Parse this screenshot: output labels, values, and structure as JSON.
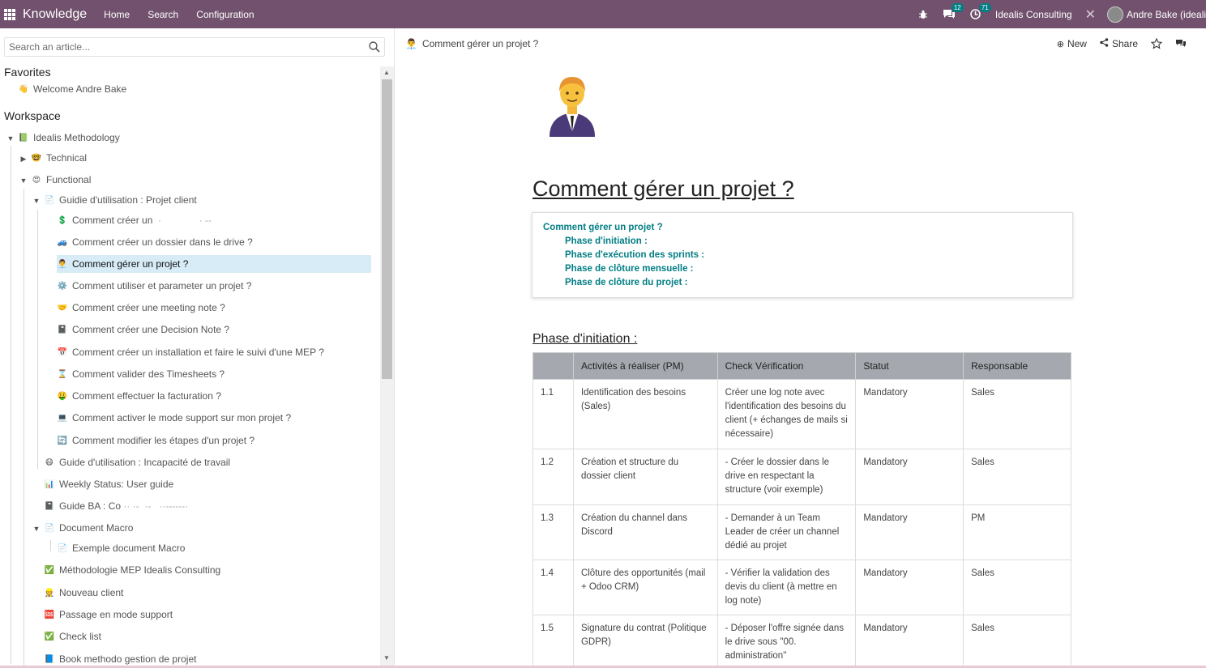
{
  "navbar": {
    "app_name": "Knowledge",
    "menu": [
      "Home",
      "Search",
      "Configuration"
    ],
    "messages_count": "12",
    "activities_count": "71",
    "company": "Idealis Consulting",
    "user": "Andre Bake (idealis"
  },
  "sidebar": {
    "search_placeholder": "Search an article...",
    "favorites_title": "Favorites",
    "favorites": [
      {
        "icon": "👋",
        "label": "Welcome Andre Bake"
      }
    ],
    "workspace_title": "Workspace",
    "tree": [
      {
        "icon": "📗",
        "label": "Idealis Methodology"
      },
      {
        "icon": "🤓",
        "label": "Technical"
      },
      {
        "icon": "😍",
        "label": "Functional"
      },
      {
        "icon": "📄",
        "label": "Guidie d'utilisation : Projet client"
      },
      {
        "icon": "💲",
        "label": "Comment créer un"
      },
      {
        "icon": "🚙",
        "label": "Comment créer un dossier dans le drive ?"
      },
      {
        "icon": "👨‍💼",
        "label": "Comment gérer un projet ?"
      },
      {
        "icon": "⚙️",
        "label": "Comment utiliser et parameter un projet ?"
      },
      {
        "icon": "🤝",
        "label": "Comment créer une meeting note ?"
      },
      {
        "icon": "📓",
        "label": "Comment créer une Decision Note ?"
      },
      {
        "icon": "📅",
        "label": "Comment créer un installation et faire le suivi d'une MEP ?"
      },
      {
        "icon": "⌛",
        "label": "Comment valider des Timesheets ?"
      },
      {
        "icon": "🤑",
        "label": "Comment effectuer la facturation ?"
      },
      {
        "icon": "💻",
        "label": "Comment activer le mode support sur mon projet ?"
      },
      {
        "icon": "🔄",
        "label": "Comment modifier les étapes d'un projet ?"
      },
      {
        "icon": "😷",
        "label": "Guide d'utilisation : Incapacité de travail"
      },
      {
        "icon": "📊",
        "label": "Weekly Status: User guide"
      },
      {
        "icon": "📓",
        "label": "Guide BA : Co"
      },
      {
        "icon": "📄",
        "label": "Document Macro"
      },
      {
        "icon": "📄",
        "label": "Exemple document Macro"
      },
      {
        "icon": "✅",
        "label": "Méthodologie MEP Idealis Consulting"
      },
      {
        "icon": "👷",
        "label": "Nouveau client"
      },
      {
        "icon": "🆘",
        "label": "Passage en mode support"
      },
      {
        "icon": "✅",
        "label": "Check list"
      },
      {
        "icon": "📘",
        "label": "Book methodo gestion de projet"
      }
    ]
  },
  "main": {
    "breadcrumb": "Comment gérer un projet ?",
    "actions": {
      "new": "New",
      "share": "Share"
    },
    "title": "Comment gérer un projet ?",
    "toc": [
      "Comment gérer un projet ?",
      "Phase d'initiation :",
      "Phase d'exécution des sprints :",
      "Phase de clôture mensuelle :",
      "Phase de clôture du projet :"
    ],
    "section_title": "Phase d'initiation :",
    "table": {
      "headers": [
        "",
        "Activités à réaliser (PM)",
        "Check Vérification",
        "Statut",
        "Responsable"
      ],
      "rows": [
        [
          "1.1",
          "Identification des besoins (Sales)",
          "Créer une log note avec l'identification des besoins du client (+ échanges de mails si nécessaire)",
          "Mandatory",
          "Sales"
        ],
        [
          "1.2",
          "Création et structure du dossier client",
          "- Créer le dossier dans le drive en respectant la structure (voir exemple)",
          "Mandatory",
          "Sales"
        ],
        [
          "1.3",
          "Création du channel dans Discord",
          "- Demander à un Team Leader de créer un channel dédié au projet",
          "Mandatory",
          "PM"
        ],
        [
          "1.4",
          "Clôture des opportunités (mail + Odoo CRM)",
          "- Vérifier la validation des devis du client (à mettre en log note)",
          "Mandatory",
          "Sales"
        ],
        [
          "1.5",
          "Signature du contrat (Politique GDPR)",
          "- Déposer l'offre signée dans le drive sous \"00. administration\"",
          "Mandatory",
          "Sales"
        ]
      ]
    }
  },
  "colors": {
    "navbar": "#71516d",
    "accent": "#017e84",
    "active_row": "#d7ecf7",
    "table_header": "#a5a9af"
  }
}
